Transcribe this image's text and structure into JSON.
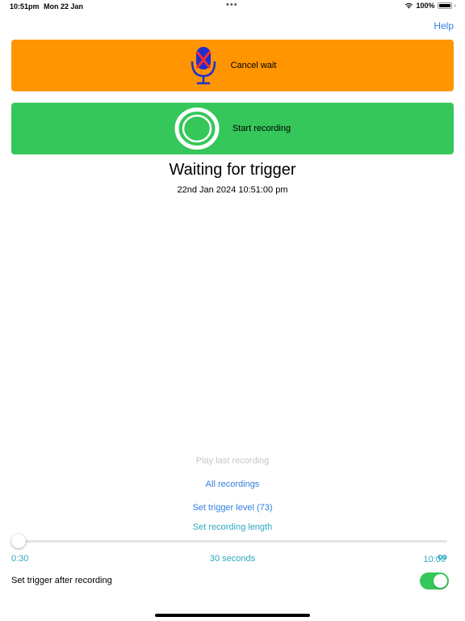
{
  "status_bar": {
    "time": "10:51pm",
    "date": "Mon 22 Jan",
    "dots": "•••",
    "battery": "100%"
  },
  "nav": {
    "help": "Help"
  },
  "buttons": {
    "cancel_wait": "Cancel wait",
    "start_recording": "Start recording",
    "cancel_color": "#ff9500",
    "record_color": "#35c759"
  },
  "main": {
    "title": "Waiting for trigger",
    "timestamp": "22nd Jan 2024 10:51:00 pm"
  },
  "links": {
    "play_last": "Play last recording",
    "all_recordings": "All recordings",
    "set_trigger_level": "Set trigger level (73)",
    "set_recording_length": "Set recording length"
  },
  "slider": {
    "min_label": "0:30",
    "value_label": "30 seconds",
    "max_label": "10:00",
    "infinity": "∞",
    "value_fraction": 0
  },
  "toggle": {
    "label": "Set trigger after recording",
    "on": true
  },
  "icons": {
    "microphone": "microphone-off-icon",
    "record": "record-circle-icon",
    "wifi": "wifi-icon",
    "battery": "battery-icon",
    "infinity": "infinity-icon"
  },
  "colors": {
    "link_blue": "#2f7fe0",
    "teal": "#2ea8c0",
    "disabled": "#c7c7cc"
  }
}
